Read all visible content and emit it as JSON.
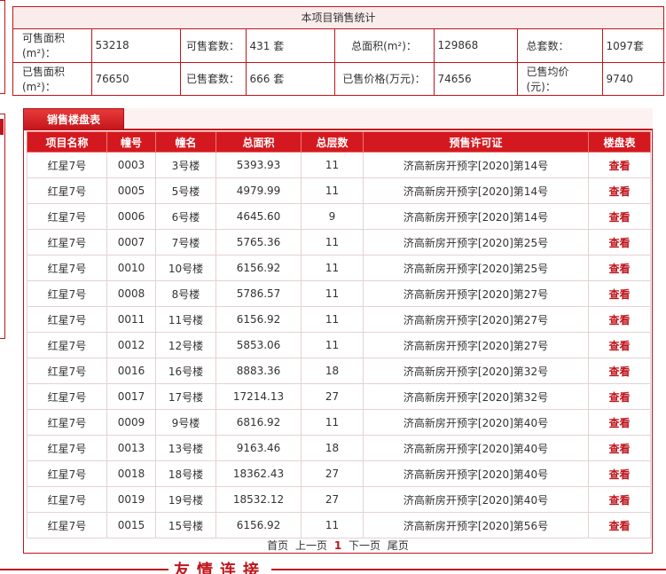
{
  "stats": {
    "title": "本项目销售统计",
    "row1": [
      {
        "label": "可售面积(m²)：",
        "value": "53218"
      },
      {
        "label": "可售套数：",
        "value": "431 套"
      },
      {
        "label": "总面积(m²)：",
        "value": "129868"
      },
      {
        "label": "总套数：",
        "value": "1097套"
      }
    ],
    "row2": [
      {
        "label": "已售面积(m²)：",
        "value": "76650"
      },
      {
        "label": "已售套数：",
        "value": "666 套"
      },
      {
        "label": "已售价格(万元)：",
        "value": "74656"
      },
      {
        "label": "已售均价(元)：",
        "value": "9740"
      }
    ]
  },
  "tab": {
    "label": "销售楼盘表"
  },
  "table": {
    "headers": [
      "项目名称",
      "幢号",
      "幢名",
      "总面积",
      "总层数",
      "预售许可证",
      "楼盘表"
    ],
    "rows": [
      [
        "红星7号",
        "0003",
        "3号楼",
        "5393.93",
        "11",
        "济高新房开预字[2020]第14号",
        "查看"
      ],
      [
        "红星7号",
        "0005",
        "5号楼",
        "4979.99",
        "11",
        "济高新房开预字[2020]第14号",
        "查看"
      ],
      [
        "红星7号",
        "0006",
        "6号楼",
        "4645.60",
        "9",
        "济高新房开预字[2020]第14号",
        "查看"
      ],
      [
        "红星7号",
        "0007",
        "7号楼",
        "5765.36",
        "11",
        "济高新房开预字[2020]第25号",
        "查看"
      ],
      [
        "红星7号",
        "0010",
        "10号楼",
        "6156.92",
        "11",
        "济高新房开预字[2020]第25号",
        "查看"
      ],
      [
        "红星7号",
        "0008",
        "8号楼",
        "5786.57",
        "11",
        "济高新房开预字[2020]第27号",
        "查看"
      ],
      [
        "红星7号",
        "0011",
        "11号楼",
        "6156.92",
        "11",
        "济高新房开预字[2020]第27号",
        "查看"
      ],
      [
        "红星7号",
        "0012",
        "12号楼",
        "5853.06",
        "11",
        "济高新房开预字[2020]第27号",
        "查看"
      ],
      [
        "红星7号",
        "0016",
        "16号楼",
        "8883.36",
        "18",
        "济高新房开预字[2020]第32号",
        "查看"
      ],
      [
        "红星7号",
        "0017",
        "17号楼",
        "17214.13",
        "27",
        "济高新房开预字[2020]第32号",
        "查看"
      ],
      [
        "红星7号",
        "0009",
        "9号楼",
        "6816.92",
        "11",
        "济高新房开预字[2020]第40号",
        "查看"
      ],
      [
        "红星7号",
        "0013",
        "13号楼",
        "9163.46",
        "18",
        "济高新房开预字[2020]第40号",
        "查看"
      ],
      [
        "红星7号",
        "0018",
        "18号楼",
        "18362.43",
        "27",
        "济高新房开预字[2020]第40号",
        "查看"
      ],
      [
        "红星7号",
        "0019",
        "19号楼",
        "18532.12",
        "27",
        "济高新房开预字[2020]第40号",
        "查看"
      ],
      [
        "红星7号",
        "0015",
        "15号楼",
        "6156.92",
        "11",
        "济高新房开预字[2020]第56号",
        "查看"
      ]
    ]
  },
  "pager": {
    "first": "首页",
    "prev": "上一页",
    "current": "1",
    "next": "下一页",
    "last": "尾页"
  },
  "footer": {
    "title": "友情连接"
  },
  "colors": {
    "accent": "#c0151b",
    "header_bg": "#d3191f",
    "title_bg": "#fbecec"
  }
}
